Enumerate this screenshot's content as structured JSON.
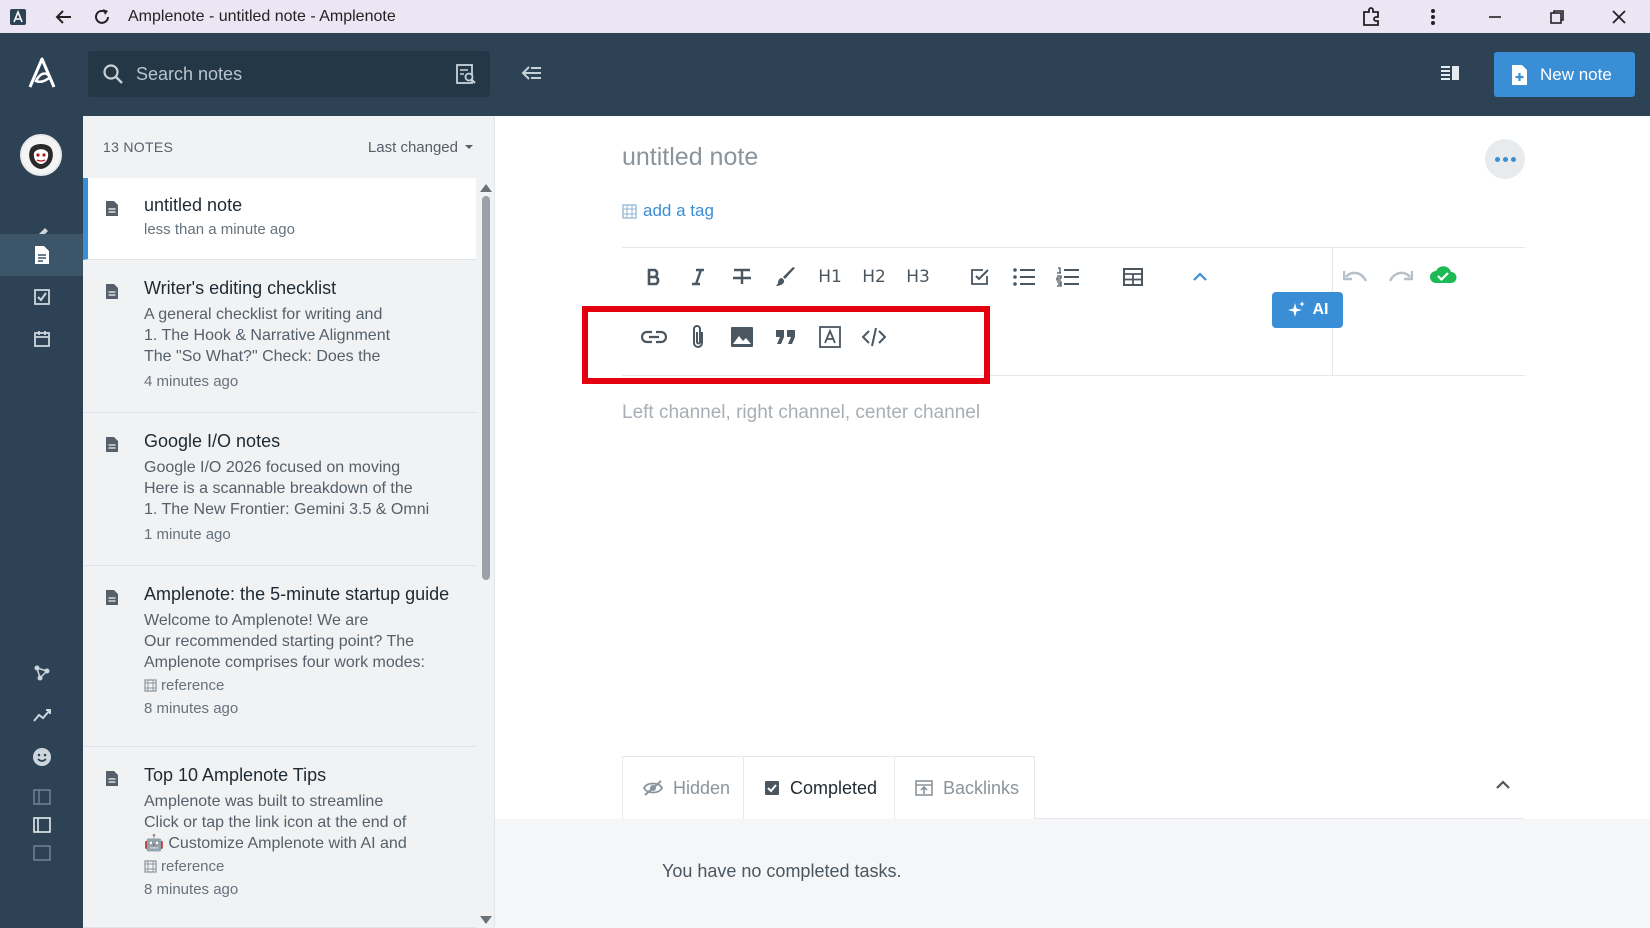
{
  "browser": {
    "title": "Amplenote - untitled note - Amplenote"
  },
  "header": {
    "search_placeholder": "Search notes",
    "new_note_label": "New note"
  },
  "notes_list": {
    "count_label": "13 NOTES",
    "sort_label": "Last changed",
    "notes": [
      {
        "title": "untitled note",
        "lines": [],
        "tag": "",
        "time": "less than a minute ago"
      },
      {
        "title": "Writer's editing checklist",
        "lines": [
          "A general checklist for writing and",
          "1. The Hook & Narrative Alignment",
          "The \"So What?\" Check: Does the"
        ],
        "tag": "",
        "time": "4 minutes ago"
      },
      {
        "title": "Google I/O notes",
        "lines": [
          "Google I/O 2026 focused on moving",
          "Here is a scannable breakdown of the",
          "1. The New Frontier: Gemini 3.5 & Omni"
        ],
        "tag": "",
        "time": "1 minute ago"
      },
      {
        "title": "Amplenote: the 5-minute startup guide",
        "lines": [
          "Welcome to Amplenote! We are",
          "Our recommended starting point? The",
          "Amplenote comprises four work modes:"
        ],
        "tag": "reference",
        "time": "8 minutes ago"
      },
      {
        "title": "Top 10 Amplenote Tips",
        "lines": [
          "Amplenote was built to streamline",
          "Click or tap the link icon at the end of",
          "🤖 Customize Amplenote with AI and"
        ],
        "tag": "reference",
        "time": "8 minutes ago"
      }
    ]
  },
  "editor": {
    "note_title": "untitled note",
    "add_tag_label": "add a tag",
    "toolbar": {
      "h1": "H1",
      "h2": "H2",
      "h3": "H3",
      "ai_label": "AI"
    },
    "placeholder": "Left channel, right channel, center channel",
    "tabs": [
      {
        "label": "Hidden"
      },
      {
        "label": "Completed"
      },
      {
        "label": "Backlinks"
      }
    ],
    "no_tasks_text": "You have no completed tasks."
  },
  "colors": {
    "header_bg": "#2d4355",
    "accent": "#3a8ed6",
    "highlight": "#e3000f",
    "sync_ok": "#1db954"
  }
}
